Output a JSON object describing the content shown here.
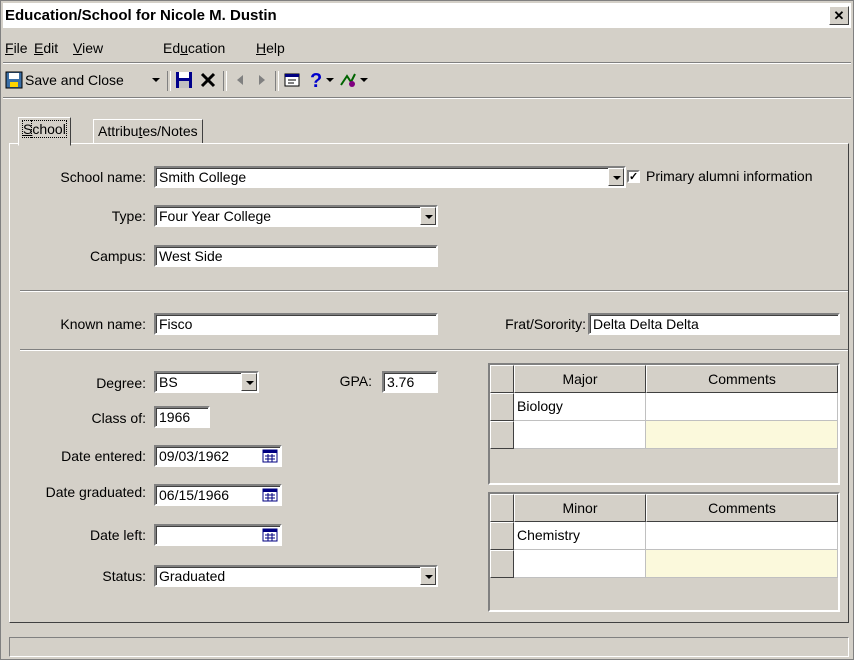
{
  "window": {
    "title": "Education/School for Nicole M. Dustin",
    "close_glyph": "✕"
  },
  "menu": [
    {
      "pre": "",
      "u": "F",
      "post": "ile"
    },
    {
      "pre": "",
      "u": "E",
      "post": "dit"
    },
    {
      "pre": "",
      "u": "V",
      "post": "iew"
    },
    {
      "pre": "Ed",
      "u": "u",
      "post": "cation"
    },
    {
      "pre": "",
      "u": "H",
      "post": "elp"
    }
  ],
  "toolbar": {
    "save_close_label": "Save and Close"
  },
  "tabs": {
    "school": {
      "u": "S",
      "rest": "chool"
    },
    "attributes": {
      "pre": "Attribu",
      "u": "t",
      "post": "es/Notes"
    }
  },
  "form": {
    "school_name_label": "School name:",
    "school_name": "Smith College",
    "primary_alumni_label": "Primary alumni information",
    "primary_alumni_checked": true,
    "type_label": "Type:",
    "type": "Four Year College",
    "campus_label": "Campus:",
    "campus": "West Side",
    "known_name_label": "Known name:",
    "known_name": "Fisco",
    "frat_label": "Frat/Sorority:",
    "frat": "Delta Delta Delta",
    "degree_label": "Degree:",
    "degree": "BS",
    "gpa_label": "GPA:",
    "gpa": "3.76",
    "class_of_label": "Class of:",
    "class_of": "1966",
    "date_entered_label": "Date entered:",
    "date_entered": "09/03/1962",
    "date_graduated_label": "Date graduated:",
    "date_graduated": "06/15/1966",
    "date_left_label": "Date left:",
    "date_left": "",
    "status_label": "Status:",
    "status": "Graduated"
  },
  "major_grid": {
    "headers": [
      "Major",
      "Comments"
    ],
    "rows": [
      [
        "Biology",
        ""
      ],
      [
        "",
        ""
      ]
    ]
  },
  "minor_grid": {
    "headers": [
      "Minor",
      "Comments"
    ],
    "rows": [
      [
        "Chemistry",
        ""
      ],
      [
        "",
        ""
      ]
    ]
  },
  "colors": {
    "title_bg": "#ffffff",
    "face": "#d4d0c8",
    "selected_cell": "#fbf9dc"
  }
}
